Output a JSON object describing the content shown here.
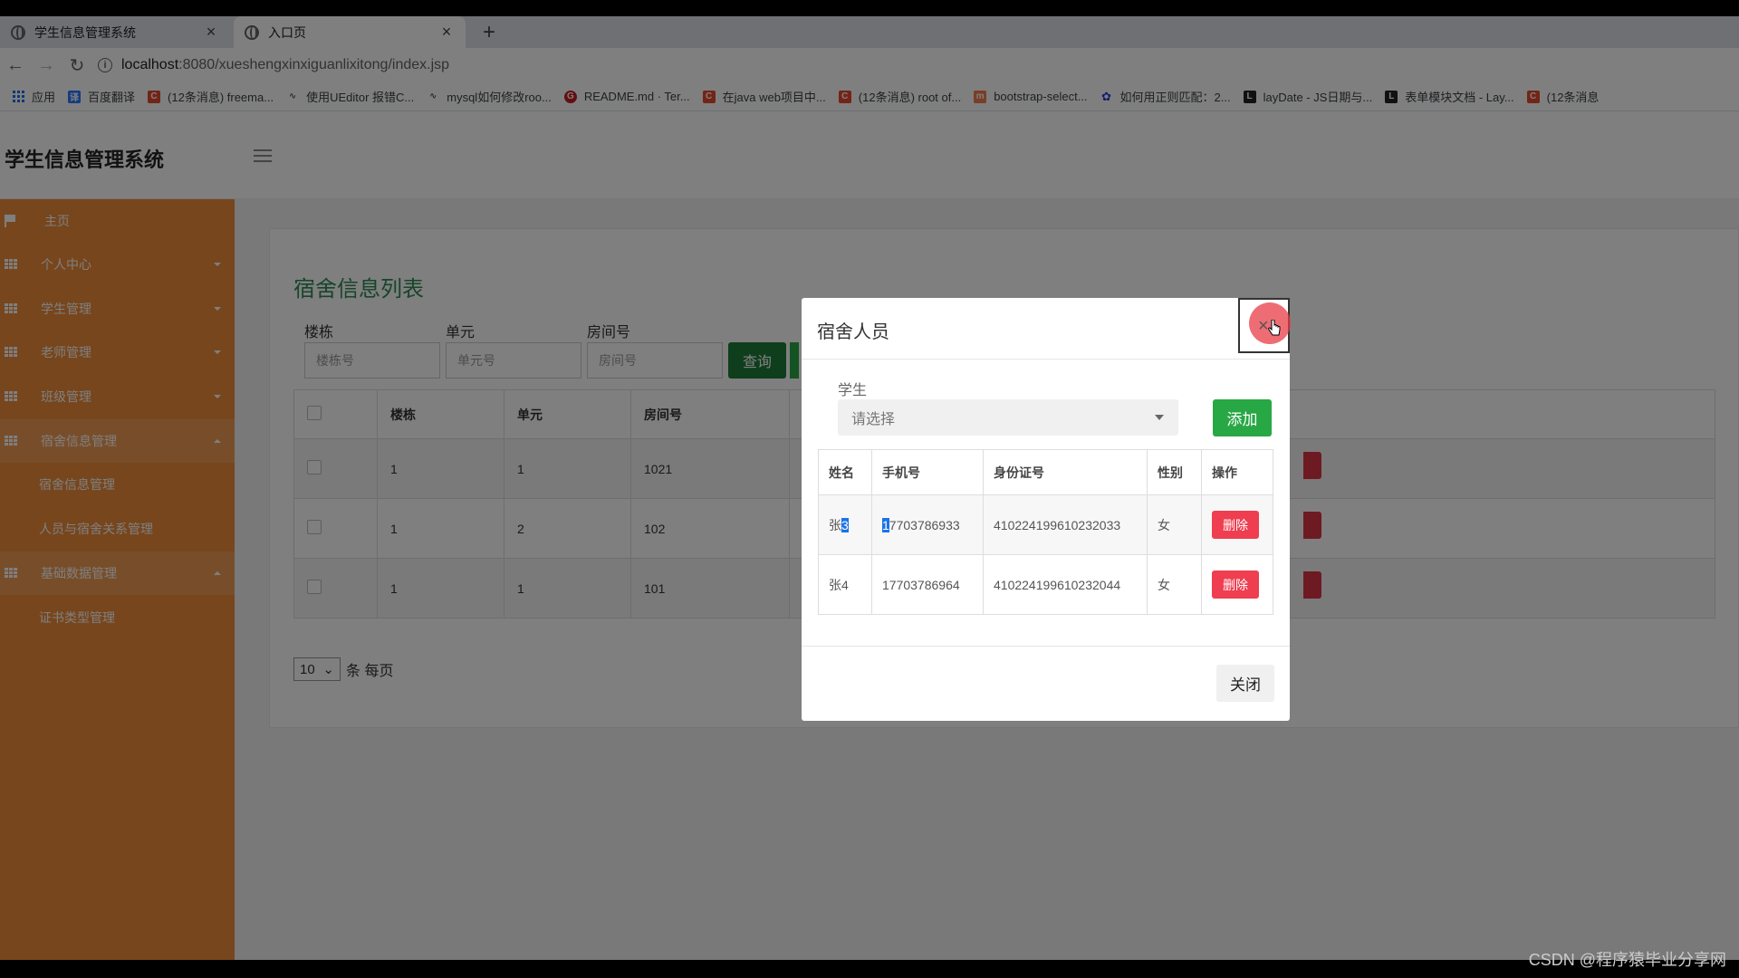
{
  "browser": {
    "tabs": [
      {
        "title": "学生信息管理系统",
        "close": "×"
      },
      {
        "title": "入口页",
        "close": "×"
      }
    ],
    "new_tab": "+",
    "nav": {
      "back": "←",
      "forward": "→",
      "reload": "↻"
    },
    "url": {
      "host": "localhost",
      "path": ":8080/xueshengxinxiguanlixitong/index.jsp"
    },
    "bookmarks": [
      {
        "label": "应用",
        "icon": "apps-icon"
      },
      {
        "label": "百度翻译",
        "icon": "baidu-translate-icon",
        "color": "#2979ff"
      },
      {
        "label": "(12条消息) freema...",
        "icon": "csdn-icon",
        "color": "#e44b2e"
      },
      {
        "label": "使用UEditor 报错C...",
        "icon": "link-icon",
        "color": "#555555"
      },
      {
        "label": "mysql如何修改roo...",
        "icon": "link-icon",
        "color": "#555555"
      },
      {
        "label": "README.md · Ter...",
        "icon": "gitee-icon",
        "color": "#c71d23"
      },
      {
        "label": "在java web项目中...",
        "icon": "csdn-icon",
        "color": "#e44b2e"
      },
      {
        "label": "(12条消息) root of...",
        "icon": "csdn-icon",
        "color": "#e44b2e"
      },
      {
        "label": "bootstrap-select...",
        "icon": "bootstrap-icon",
        "color": "#f07c4e"
      },
      {
        "label": "如何用正则匹配：2...",
        "icon": "baidu-paw-icon",
        "color": "#2932e1"
      },
      {
        "label": "layDate - JS日期与...",
        "icon": "layui-icon",
        "color": "#222222"
      },
      {
        "label": "表单模块文档 - Lay...",
        "icon": "layui-icon",
        "color": "#222222"
      },
      {
        "label": "(12条消息",
        "icon": "csdn-icon",
        "color": "#e44b2e"
      }
    ]
  },
  "app": {
    "title": "学生信息管理系统",
    "sidebar": {
      "home": "主页",
      "groups": [
        {
          "label": "个人中心"
        },
        {
          "label": "学生管理"
        },
        {
          "label": "老师管理"
        },
        {
          "label": "班级管理"
        },
        {
          "label": "宿舍信息管理",
          "children": [
            "宿舍信息管理",
            "人员与宿舍关系管理"
          ]
        },
        {
          "label": "基础数据管理",
          "children": [
            "证书类型管理"
          ]
        }
      ]
    }
  },
  "dorm_list": {
    "title": "宿舍信息列表",
    "filters": [
      {
        "label": "楼栋",
        "placeholder": "楼栋号"
      },
      {
        "label": "单元",
        "placeholder": "单元号"
      },
      {
        "label": "房间号",
        "placeholder": "房间号"
      }
    ],
    "query_label": "查询",
    "columns": [
      "楼栋",
      "单元",
      "房间号"
    ],
    "rows": [
      [
        "1",
        "1",
        "1021"
      ],
      [
        "1",
        "2",
        "102"
      ],
      [
        "1",
        "1",
        "101"
      ]
    ],
    "page_size": "10",
    "page_size_suffix": "条 每页"
  },
  "modal": {
    "title": "宿舍人员",
    "close_glyph": "×",
    "student_label": "学生",
    "student_placeholder": "请选择",
    "add_label": "添加",
    "columns": [
      "姓名",
      "手机号",
      "身份证号",
      "性别",
      "操作"
    ],
    "rows": [
      {
        "name_a": "张",
        "name_b": "3",
        "phone_a": "1",
        "phone_b": "7703786933",
        "id_no": "410224199610232033",
        "gender": "女",
        "action": "删除"
      },
      {
        "name": "张4",
        "phone": "17703786964",
        "id_no": "410224199610232044",
        "gender": "女",
        "action": "删除"
      }
    ],
    "footer_close": "关闭"
  },
  "watermark": "CSDN @程序猿毕业分享网"
}
